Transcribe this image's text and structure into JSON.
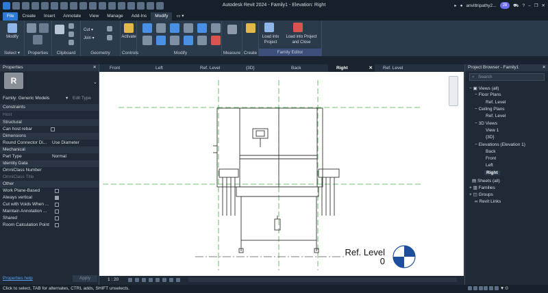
{
  "app": {
    "window_title": "Autodesk Revit 2024 - Family1 - Elevation: Right",
    "user": "anvittripathy2...",
    "notification_count": "28"
  },
  "menu_tabs": [
    "File",
    "Create",
    "Insert",
    "Annotate",
    "View",
    "Manage",
    "Add-Ins",
    "Modify"
  ],
  "ribbon": {
    "modify_label": "Modify",
    "select_label": "Select ▾",
    "properties_label": "Properties",
    "clipboard_label": "Clipboard",
    "cut_label": "Cut ▾",
    "join_label": "Join ▾",
    "geometry_label": "Geometry",
    "activate_label": "Activate",
    "controls_label": "Controls",
    "modify_group_label": "Modify",
    "measure_label": "Measure",
    "create_label": "Create",
    "load_into_project": "Load into Project",
    "load_into_project_close": "Load into Project and Close",
    "family_editor_label": "Family Editor"
  },
  "properties": {
    "title": "Properties",
    "family_selector": "Family: Generic Models",
    "edit_type": "Edit Type",
    "rows": {
      "constraints": "Constraints",
      "host": "Host",
      "structural": "Structural",
      "can_host_rebar": "Can host rebar",
      "dimensions": "Dimensions",
      "round_connector": "Round Connector Di...",
      "round_connector_val": "Use Diameter",
      "mechanical": "Mechanical",
      "part_type": "Part Type",
      "part_type_val": "Normal",
      "identity_data": "Identity Data",
      "omniclass_number": "OmniClass Number",
      "omniclass_title": "OmniClass Title",
      "other": "Other",
      "work_plane_based": "Work Plane-Based",
      "always_vertical": "Always vertical",
      "cut_with_voids": "Cut with Voids When ...",
      "maintain_annotation": "Maintain Annotation ...",
      "shared": "Shared",
      "room_calc_point": "Room Calculation Point"
    },
    "help_link": "Properties help",
    "apply_button": "Apply"
  },
  "view_tabs": [
    "Front",
    "Left",
    "Ref. Level",
    "{3D}",
    "Back",
    "Right",
    "Ref. Level"
  ],
  "active_view_tab": "Right",
  "canvas": {
    "level_name": "Ref. Level",
    "level_elevation": "0"
  },
  "view_control_bar": {
    "scale": "1 : 20"
  },
  "project_browser": {
    "title": "Project Browser - Family1",
    "search_placeholder": "Search",
    "items": {
      "views_all": "Views (all)",
      "floor_plans": "Floor Plans",
      "fp_ref_level": "Ref. Level",
      "ceiling_plans": "Ceiling Plans",
      "cp_ref_level": "Ref. Level",
      "views_3d": "3D Views",
      "view_1": "View 1",
      "view_3d": "{3D}",
      "elevations": "Elevations (Elevation 1)",
      "el_back": "Back",
      "el_front": "Front",
      "el_left": "Left",
      "el_right": "Right",
      "sheets_all": "Sheets (all)",
      "families": "Families",
      "groups": "Groups",
      "revit_links": "Revit Links"
    }
  },
  "status_bar": {
    "message": "Click to select, TAB for alternates, CTRL adds, SHIFT unselects.",
    "filter_count": ":0"
  },
  "colors": {
    "accent": "#2d7bd4",
    "panel_bg": "#1f2a36",
    "ribbon_bg": "#2c3b4b",
    "ref_plane": "#3fae3f"
  }
}
